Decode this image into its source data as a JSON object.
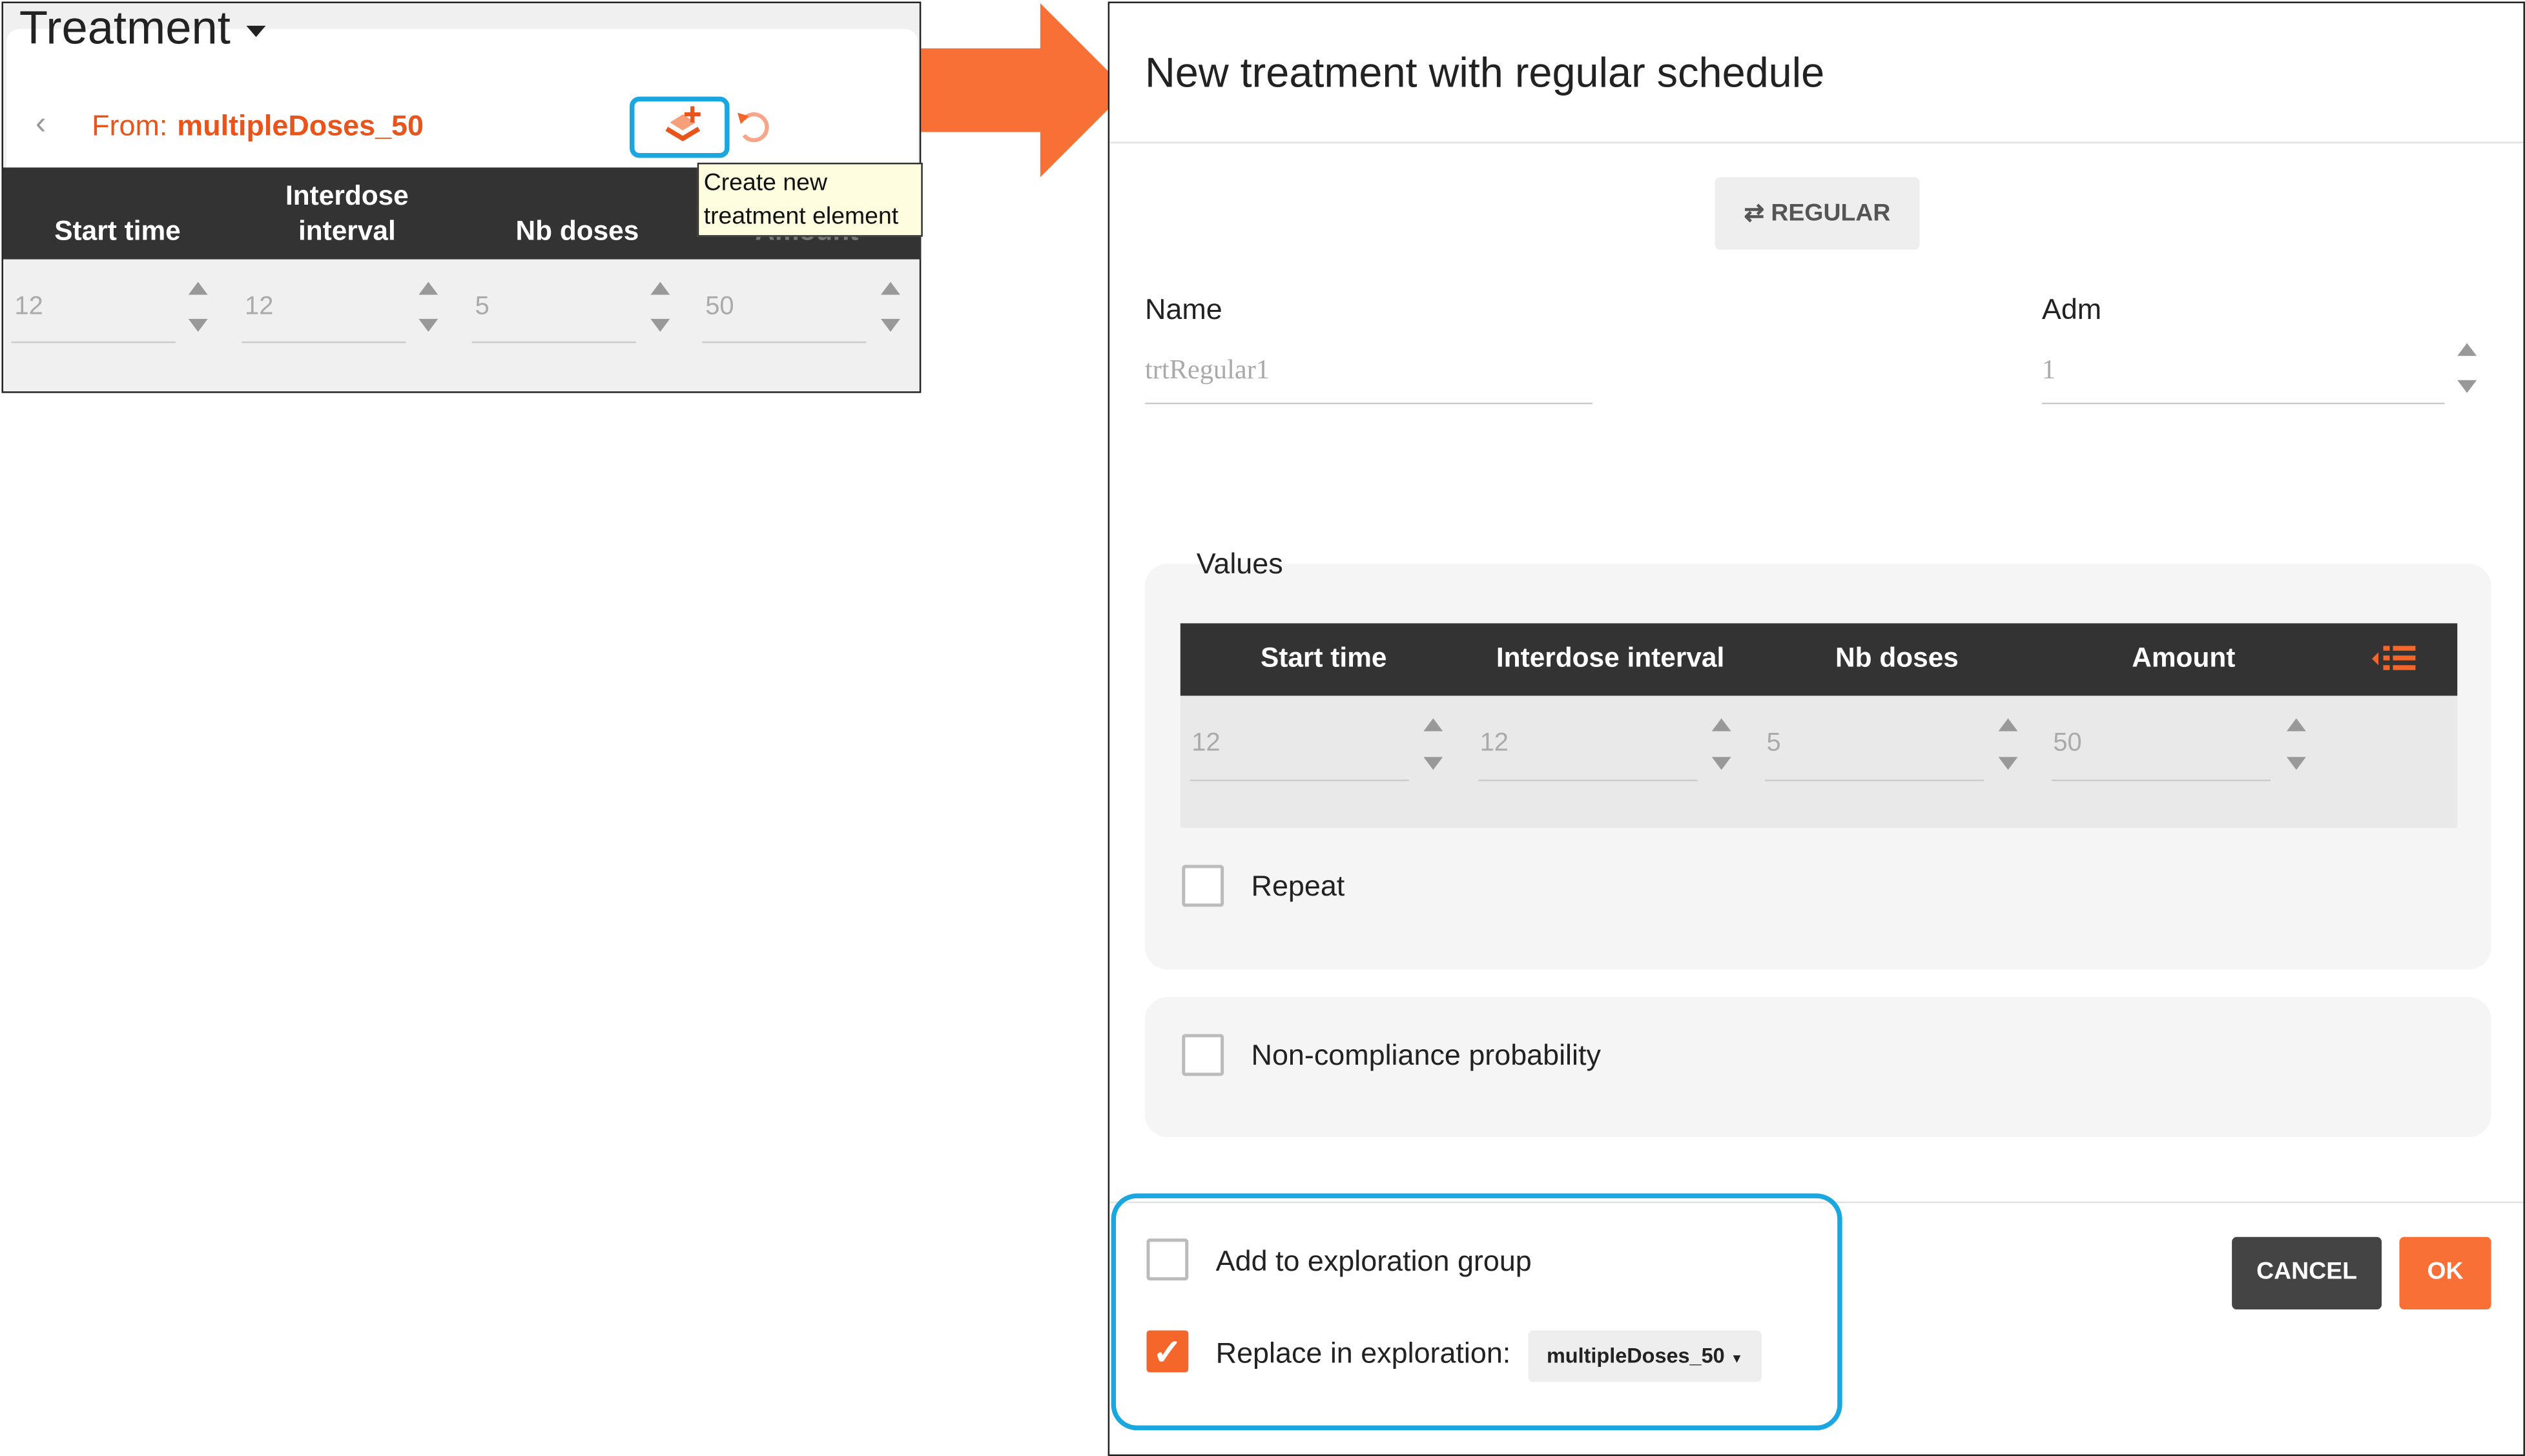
{
  "left_panel": {
    "title": "Treatment",
    "from_label": "From:",
    "from_value": "multipleDoses_50",
    "columns": [
      "Start time",
      "Interdose",
      "interval",
      "Nb doses",
      "Amount"
    ],
    "values": [
      "12",
      "12",
      "5",
      "50"
    ],
    "tooltip_line1": "Create new",
    "tooltip_line2": "treatment element",
    "icons": [
      "chevron-left-icon",
      "layers-add-icon",
      "reset-icon",
      "caret-down-icon"
    ]
  },
  "dialog": {
    "title": "New treatment with regular schedule",
    "mode_button": "REGULAR",
    "name_label": "Name",
    "name_value": "trtRegular1",
    "adm_label": "Adm",
    "adm_value": "1",
    "values_legend": "Values",
    "columns": [
      "Start time",
      "Interdose interval",
      "Nb doses",
      "Amount"
    ],
    "values": [
      "12",
      "12",
      "5",
      "50"
    ],
    "repeat_label": "Repeat",
    "noncompliance_label": "Non-compliance probability",
    "add_group_label": "Add to exploration group",
    "replace_label": "Replace in exploration:",
    "replace_value": "multipleDoses_50",
    "replace_checked": true,
    "add_group_checked": false,
    "cancel": "CANCEL",
    "ok": "OK"
  },
  "colors": {
    "accent": "#f5662a",
    "highlight": "#1aa7e0",
    "header": "#333333"
  }
}
